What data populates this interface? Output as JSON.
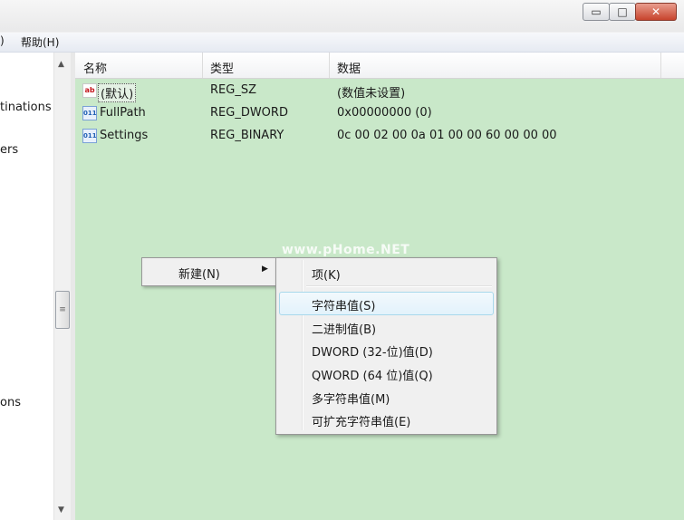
{
  "window": {
    "minimize_label": "▭",
    "maximize_label": "□",
    "close_label": "✕"
  },
  "menubar": {
    "partial_prev_label": ")",
    "help_label": "帮助(H)"
  },
  "tree": {
    "items": [
      "tinations",
      "ers",
      "ons"
    ]
  },
  "list": {
    "columns": [
      "名称",
      "类型",
      "数据"
    ],
    "rows": [
      {
        "icon": "string-value-icon",
        "name": "(默认)",
        "type": "REG_SZ",
        "data": "(数值未设置)"
      },
      {
        "icon": "binary-value-icon",
        "name": "FullPath",
        "type": "REG_DWORD",
        "data": "0x00000000 (0)"
      },
      {
        "icon": "binary-value-icon",
        "name": "Settings",
        "type": "REG_BINARY",
        "data": "0c 00 02 00 0a 01 00 00 60 00 00 00"
      }
    ],
    "watermark": "www.pHome.NET"
  },
  "context_menu": {
    "new_label": "新建(N)",
    "submenu": {
      "key_label": "项(K)",
      "items": [
        "字符串值(S)",
        "二进制值(B)",
        "DWORD (32-位)值(D)",
        "QWORD (64 位)值(Q)",
        "多字符串值(M)",
        "可扩充字符串值(E)"
      ],
      "highlighted_index": 0
    }
  }
}
